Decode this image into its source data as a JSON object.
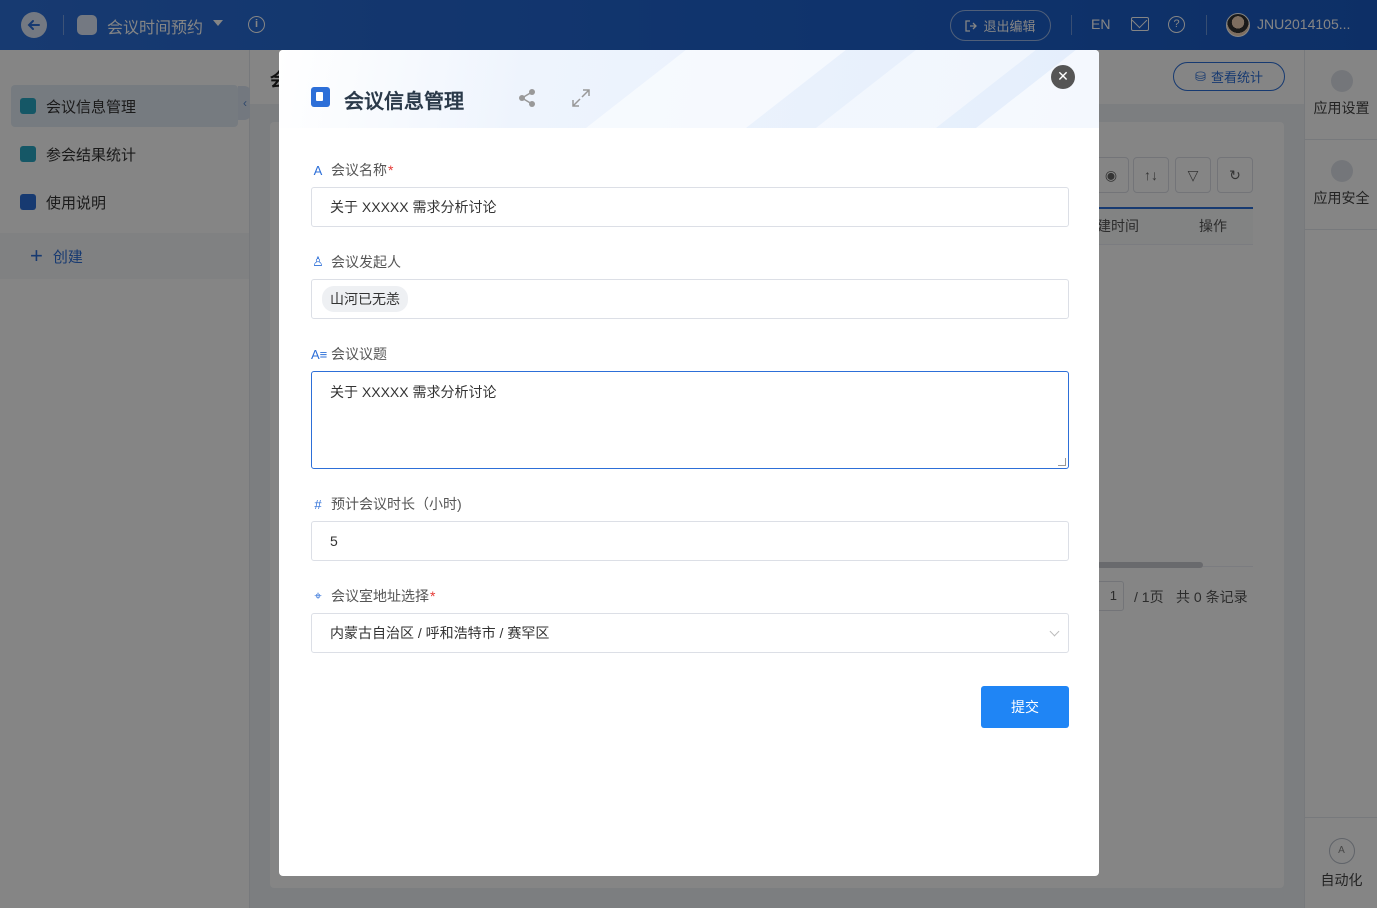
{
  "topbar": {
    "app_title": "会议时间预约",
    "exit_edit": "退出编辑",
    "lang": "EN",
    "user_name": "JNU2014105..."
  },
  "sidebar": {
    "items": [
      {
        "label": "会议信息管理",
        "icon": "table-icon",
        "color": "#2aa8c4"
      },
      {
        "label": "参会结果统计",
        "icon": "table-icon",
        "color": "#2aa8c4"
      },
      {
        "label": "使用说明",
        "icon": "edit-doc-icon",
        "color": "#2d6fd8"
      }
    ],
    "create_label": "创建"
  },
  "main": {
    "title_fragment": "会",
    "stats_button": "查看统计",
    "table_headers": [
      "建时间",
      "操作"
    ],
    "pager": {
      "page": "1",
      "total_pages": "/ 1页",
      "records": "共 0 条记录"
    }
  },
  "rightbar": {
    "app_settings": "应用设置",
    "app_security": "应用安全",
    "automation": "自动化"
  },
  "modal": {
    "title": "会议信息管理",
    "fields": {
      "name": {
        "label": "会议名称",
        "required": "*",
        "value": "关于 XXXXX 需求分析讨论"
      },
      "initiator": {
        "label": "会议发起人",
        "value": "山河已无恙"
      },
      "topic": {
        "label": "会议议题",
        "value": "关于 XXXXX 需求分析讨论"
      },
      "duration": {
        "label": "预计会议时长（小时)",
        "value": "5"
      },
      "location": {
        "label": "会议室地址选择",
        "required": "*",
        "value": "内蒙古自治区 / 呼和浩特市 / 赛罕区"
      }
    },
    "submit": "提交"
  },
  "colors": {
    "brand": "#2d6fd8",
    "submit": "#1f85f5",
    "required": "#e53935"
  }
}
